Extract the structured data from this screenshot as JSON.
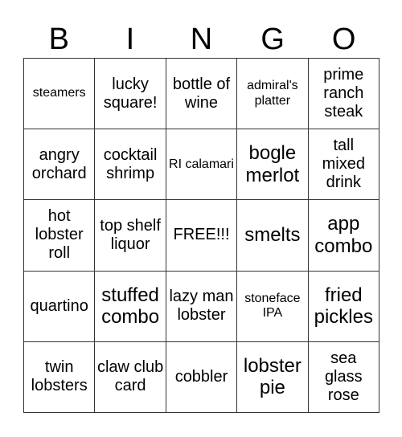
{
  "header": {
    "letters": [
      "B",
      "I",
      "N",
      "G",
      "O"
    ]
  },
  "board": {
    "cells": [
      [
        {
          "text": "steamers",
          "size": "sm"
        },
        {
          "text": "lucky square!",
          "size": "md"
        },
        {
          "text": "bottle of wine",
          "size": "md"
        },
        {
          "text": "admiral's platter",
          "size": "sm"
        },
        {
          "text": "prime ranch steak",
          "size": "md"
        }
      ],
      [
        {
          "text": "angry orchard",
          "size": "md"
        },
        {
          "text": "cocktail shrimp",
          "size": "md"
        },
        {
          "text": "RI calamari",
          "size": "sm"
        },
        {
          "text": "bogle merlot",
          "size": "lg"
        },
        {
          "text": "tall mixed drink",
          "size": "md"
        }
      ],
      [
        {
          "text": "hot lobster roll",
          "size": "md"
        },
        {
          "text": "top shelf liquor",
          "size": "md"
        },
        {
          "text": "FREE!!!",
          "size": "md"
        },
        {
          "text": "smelts",
          "size": "lg"
        },
        {
          "text": "app combo",
          "size": "lg"
        }
      ],
      [
        {
          "text": "quartino",
          "size": "md"
        },
        {
          "text": "stuffed combo",
          "size": "lg"
        },
        {
          "text": "lazy man lobster",
          "size": "md"
        },
        {
          "text": "stoneface IPA",
          "size": "sm"
        },
        {
          "text": "fried pickles",
          "size": "lg"
        }
      ],
      [
        {
          "text": "twin lobsters",
          "size": "md"
        },
        {
          "text": "claw club card",
          "size": "md"
        },
        {
          "text": "cobbler",
          "size": "md"
        },
        {
          "text": "lobster pie",
          "size": "lg"
        },
        {
          "text": "sea glass rose",
          "size": "md"
        }
      ]
    ]
  }
}
